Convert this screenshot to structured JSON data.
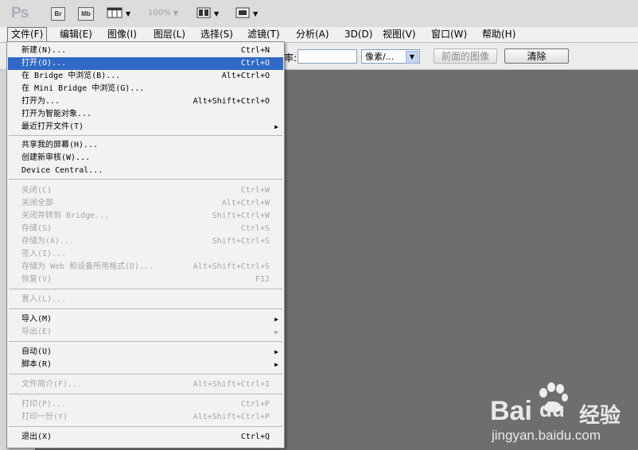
{
  "toolbar": {
    "logo": "Ps",
    "bridge": "Br",
    "minibridge": "Mb",
    "zoom": "100%"
  },
  "menubar": [
    "文件(F)",
    "编辑(E)",
    "图像(I)",
    "图层(L)",
    "选择(S)",
    "滤镜(T)",
    "分析(A)",
    "3D(D)",
    "视图(V)",
    "窗口(W)",
    "帮助(H)"
  ],
  "options": {
    "label": "率:",
    "unit": "像素/...",
    "front_image": "前面的图像",
    "clear": "清除"
  },
  "file_menu": {
    "items": [
      {
        "label": "新建(N)...",
        "shortcut": "Ctrl+N"
      },
      {
        "label": "打开(O)...",
        "shortcut": "Ctrl+O"
      },
      {
        "label": "在 Bridge 中浏览(B)...",
        "shortcut": "Alt+Ctrl+O"
      },
      {
        "label": "在 Mini Bridge 中浏览(G)...",
        "shortcut": ""
      },
      {
        "label": "打开为...",
        "shortcut": "Alt+Shift+Ctrl+O"
      },
      {
        "label": "打开为智能对象...",
        "shortcut": ""
      },
      {
        "label": "最近打开文件(T)",
        "shortcut": ""
      },
      {
        "label": "共享我的屏幕(H)...",
        "shortcut": ""
      },
      {
        "label": "创建新审核(W)...",
        "shortcut": ""
      },
      {
        "label": "Device Central...",
        "shortcut": ""
      },
      {
        "label": "关闭(C)",
        "shortcut": "Ctrl+W"
      },
      {
        "label": "关闭全部",
        "shortcut": "Alt+Ctrl+W"
      },
      {
        "label": "关闭并转到 Bridge...",
        "shortcut": "Shift+Ctrl+W"
      },
      {
        "label": "存储(S)",
        "shortcut": "Ctrl+S"
      },
      {
        "label": "存储为(A)...",
        "shortcut": "Shift+Ctrl+S"
      },
      {
        "label": "签入(I)...",
        "shortcut": ""
      },
      {
        "label": "存储为 Web 和设备所用格式(D)...",
        "shortcut": "Alt+Shift+Ctrl+S"
      },
      {
        "label": "恢复(V)",
        "shortcut": "F12"
      },
      {
        "label": "置入(L)...",
        "shortcut": ""
      },
      {
        "label": "导入(M)",
        "shortcut": ""
      },
      {
        "label": "导出(E)",
        "shortcut": ""
      },
      {
        "label": "自动(U)",
        "shortcut": ""
      },
      {
        "label": "脚本(R)",
        "shortcut": ""
      },
      {
        "label": "文件简介(F)...",
        "shortcut": "Alt+Shift+Ctrl+I"
      },
      {
        "label": "打印(P)...",
        "shortcut": "Ctrl+P"
      },
      {
        "label": "打印一份(Y)",
        "shortcut": "Alt+Shift+Ctrl+P"
      },
      {
        "label": "退出(X)",
        "shortcut": "Ctrl+Q"
      }
    ]
  },
  "watermark": {
    "brand": "Bai",
    "brand2": "du",
    "product": "经验",
    "url": "jingyan.baidu.com"
  }
}
